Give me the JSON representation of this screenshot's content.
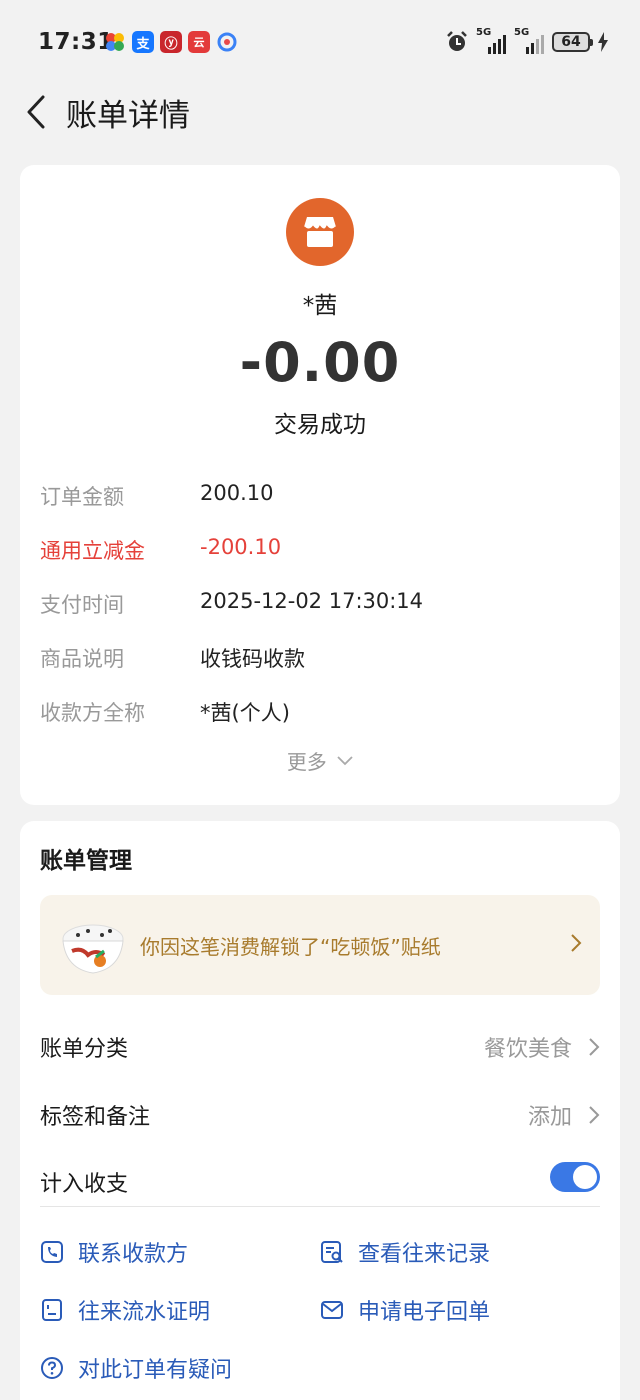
{
  "status_bar": {
    "time": "17:31",
    "notifications": [
      {
        "icon": "google-photos-icon"
      },
      {
        "icon": "alipay-icon",
        "glyph": "支",
        "color": "#1677ff"
      },
      {
        "icon": "bank-icon",
        "glyph": "ⓨ",
        "color": "#c9262c"
      },
      {
        "icon": "yunshanfu-icon",
        "glyph": "云",
        "color": "#e33a3a"
      },
      {
        "icon": "nfc-app-icon"
      }
    ],
    "alarm_icon": "alarm-icon",
    "signal1_label": "5G",
    "signal2_label": "5G",
    "battery": "64"
  },
  "nav": {
    "title": "账单详情"
  },
  "transaction": {
    "merchant": "*茜",
    "amount": "-0.00",
    "status": "交易成功",
    "details": [
      {
        "label": "订单金额",
        "value": "200.10",
        "highlight": false
      },
      {
        "label": "通用立减金",
        "value": "-200.10",
        "highlight": true
      },
      {
        "label": "支付时间",
        "value": "2025-12-02 17:30:14",
        "highlight": false
      },
      {
        "label": "商品说明",
        "value": "收钱码收款",
        "highlight": false
      },
      {
        "label": "收款方全称",
        "value": "*茜(个人)",
        "highlight": false
      }
    ],
    "more_label": "更多"
  },
  "management": {
    "title": "账单管理",
    "sticker_text": "你因这笔消费解锁了“吃顿饭”贴纸",
    "category_label": "账单分类",
    "category_value": "餐饮美食",
    "tag_label": "标签和备注",
    "tag_value": "添加",
    "include_label": "计入收支",
    "include_enabled": true,
    "actions": {
      "contact": "联系收款方",
      "history": "查看往来记录",
      "statement": "往来流水证明",
      "receipt": "申请电子回单",
      "question": "对此订单有疑问"
    }
  },
  "colors": {
    "accent": "#3a78e5",
    "link": "#2a5bb8",
    "merchant": "#e2662c",
    "discount": "#e5413a",
    "sticker_text": "#a87b2d"
  }
}
